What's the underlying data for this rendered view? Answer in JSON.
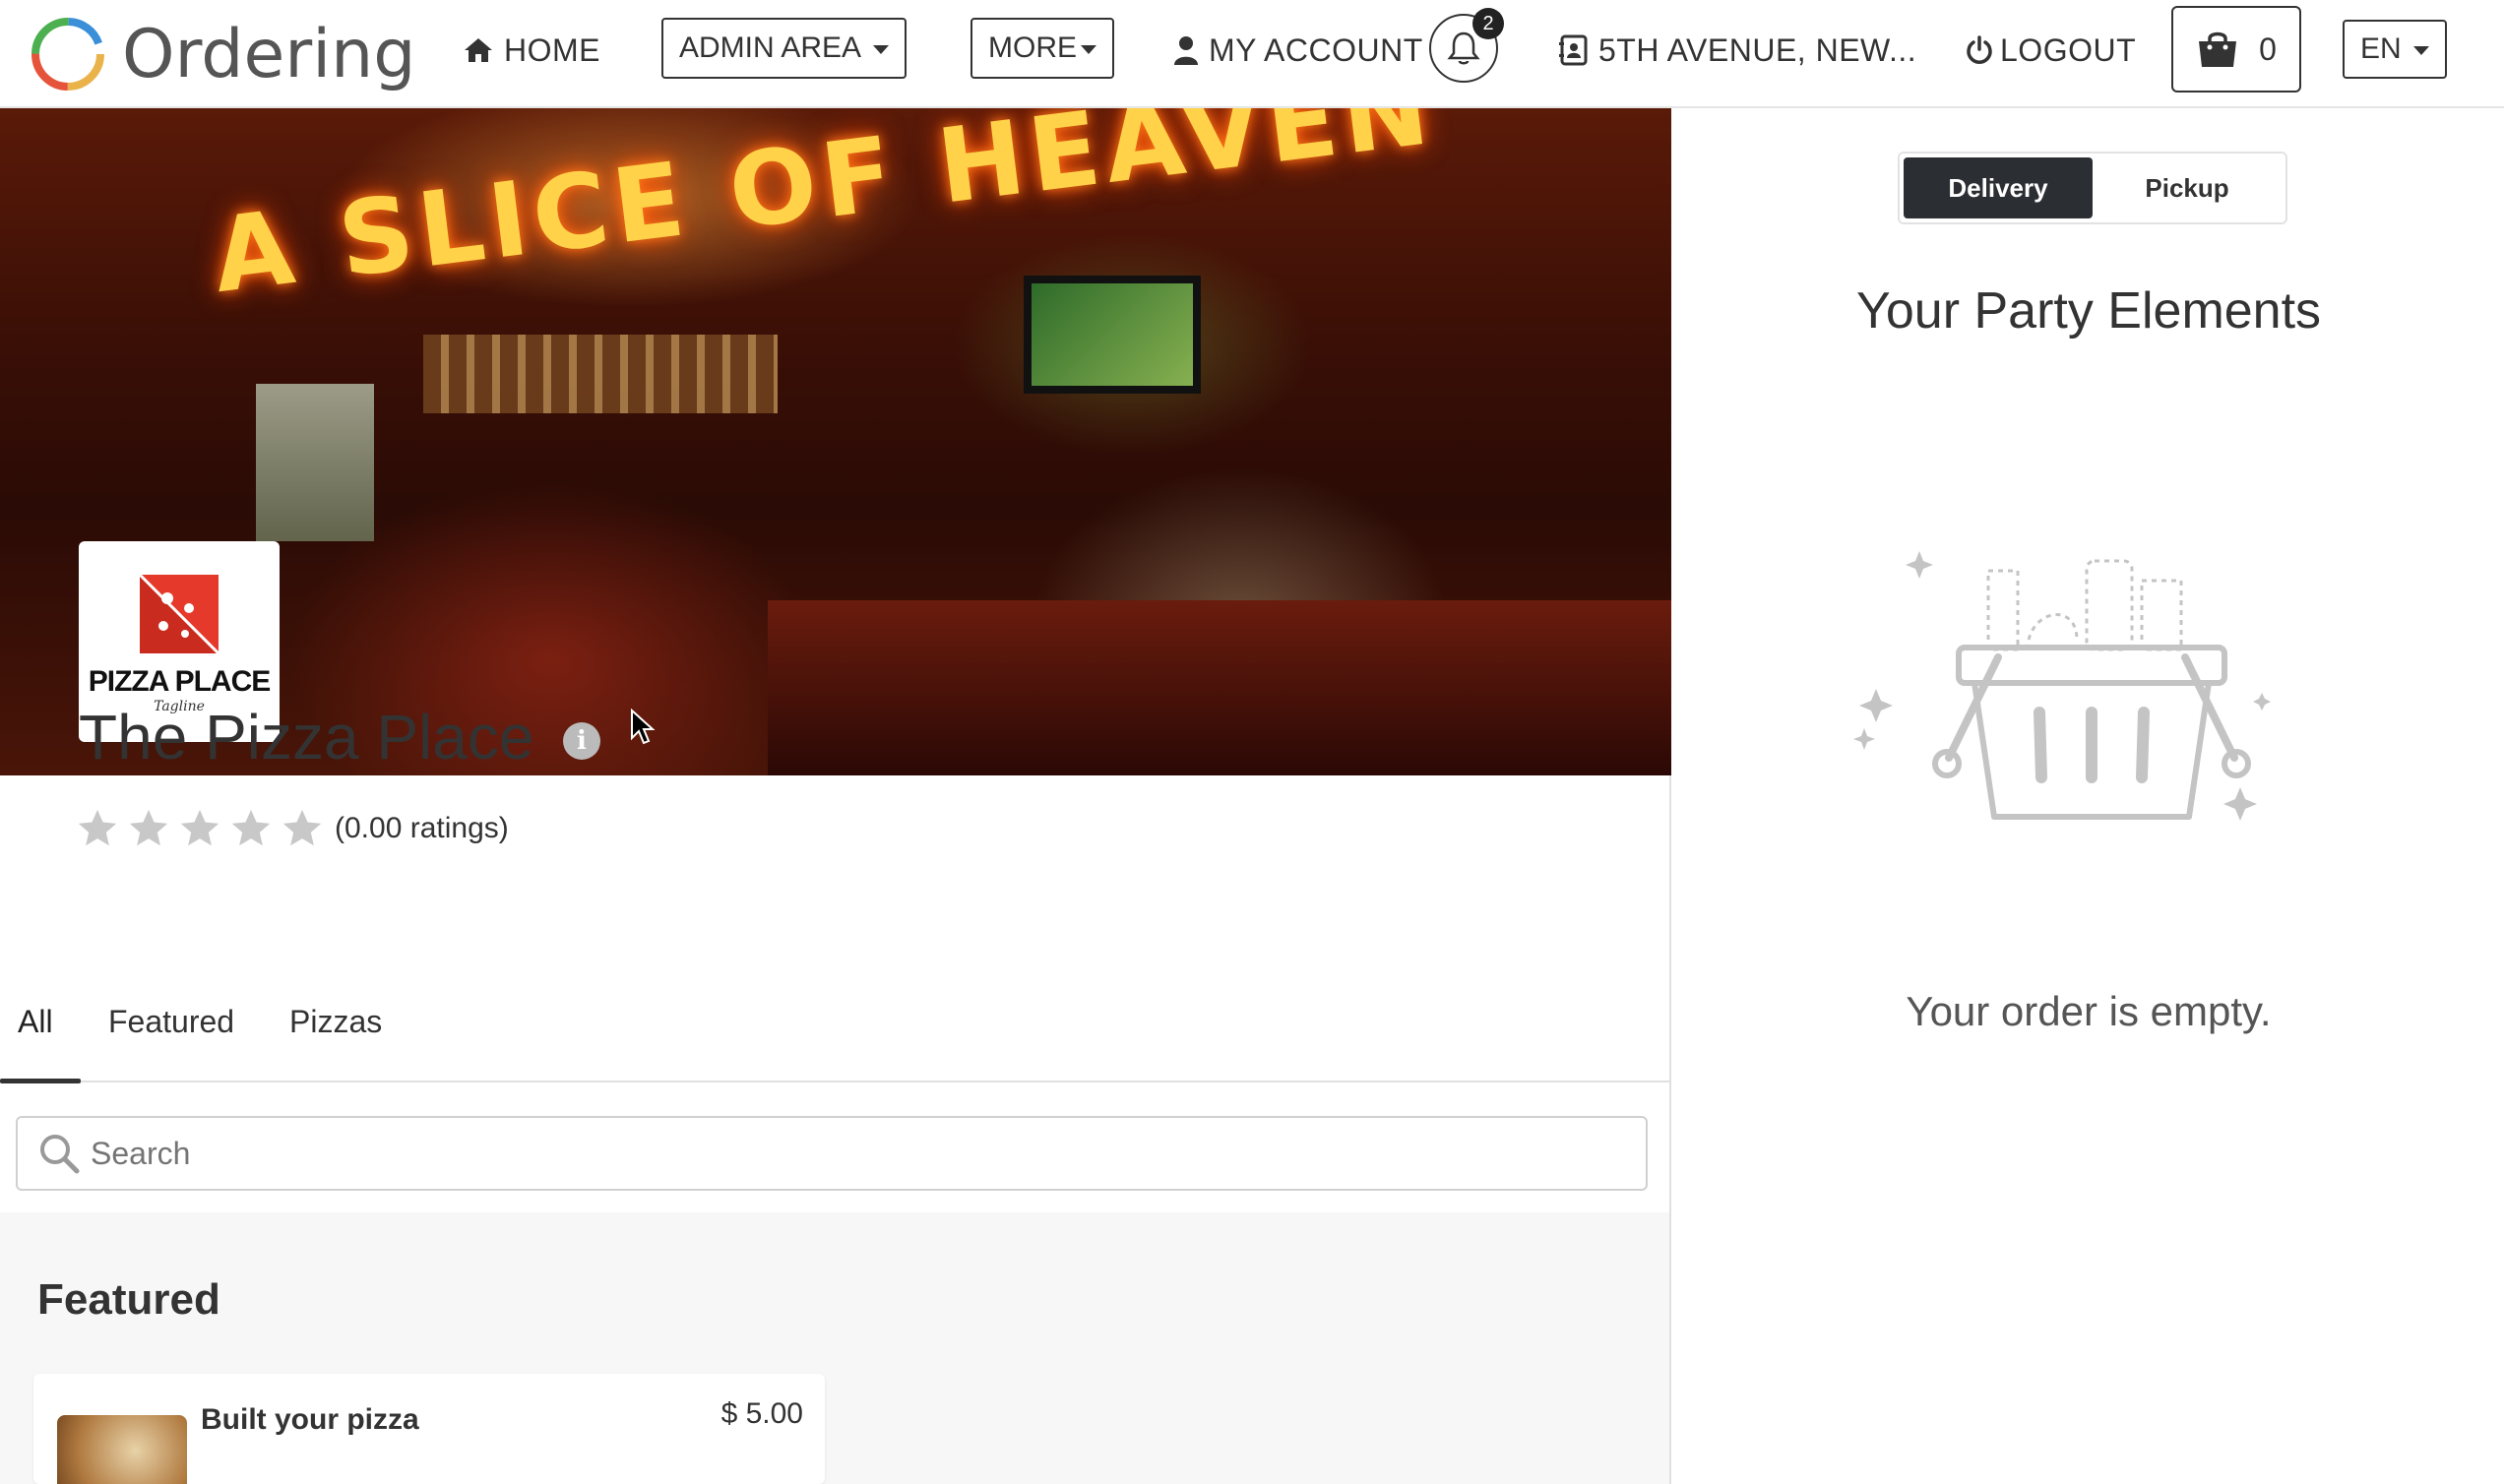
{
  "navbar": {
    "brand": "Ordering",
    "home": "HOME",
    "admin_area": "ADMIN AREA",
    "more": "MORE",
    "my_account": "MY ACCOUNT",
    "notifications_count": "2",
    "address": "5TH AVENUE, NEW...",
    "logout": "LOGOUT",
    "cart_count": "0",
    "language": "EN"
  },
  "store": {
    "name": "The Pizza Place",
    "logo_text": "PIZZA PLACE",
    "logo_sub": "Tagline",
    "rating_value": 0,
    "rating_max": 5,
    "rating_text": "(0.00 ratings)",
    "hero_sign": "A SLICE OF HEAVEN"
  },
  "tabs": [
    "All",
    "Featured",
    "Pizzas"
  ],
  "active_tab": "All",
  "search": {
    "placeholder": "Search"
  },
  "featured": {
    "title": "Featured",
    "products": [
      {
        "name": "Built your pizza",
        "price": "$ 5.00"
      }
    ]
  },
  "cart": {
    "delivery": "Delivery",
    "pickup": "Pickup",
    "selected_mode": "Delivery",
    "title": "Your Party Elements",
    "empty_text": "Your order is empty."
  },
  "colors": {
    "primary_dark": "#2b2e33",
    "text": "#333333",
    "star_empty": "#c8c8c8",
    "logo_red": "#e53a2b"
  },
  "icons": {
    "home": "home-icon",
    "account": "user-icon",
    "notifications": "bell-icon",
    "address": "address-book-icon",
    "logout": "power-icon",
    "cart": "shopping-bag-icon",
    "search": "search-icon",
    "info": "info-icon",
    "basket": "empty-basket-illustration"
  }
}
